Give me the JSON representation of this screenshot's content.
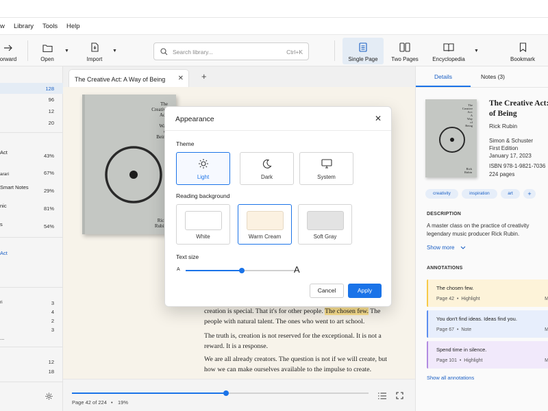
{
  "menu": [
    "w",
    "Library",
    "Tools",
    "Help"
  ],
  "toolbar": {
    "forward_label": "orward",
    "open_label": "Open",
    "import_label": "Import",
    "search_placeholder": "Search library...",
    "search_shortcut": "Ctrl+K",
    "single_page_label": "Single Page",
    "two_pages_label": "Two Pages",
    "encyclopedia_label": "Encyclopedia",
    "bookmark_label": "Bookmark"
  },
  "sidebar": {
    "top_counts": [
      "128",
      "96",
      "12",
      "20"
    ],
    "reading": [
      {
        "label": "Act",
        "value": "43%"
      },
      {
        "label": "arari",
        "value": "67%"
      },
      {
        "label": "Smart Notes",
        "value": "29%"
      },
      {
        "label": "nic",
        "value": "81%"
      },
      {
        "label": "s",
        "value": "54%"
      }
    ],
    "active_item": "Act",
    "authors": [
      {
        "label": "ri",
        "value": "3"
      },
      {
        "label": "",
        "value": "4"
      },
      {
        "label": "",
        "value": "2"
      },
      {
        "label": "",
        "value": "3"
      },
      {
        "label": "...",
        "value": ""
      }
    ],
    "bottom_counts": [
      "12",
      "18"
    ]
  },
  "tabs": {
    "active_title": "The Creative Act: A Way of Being"
  },
  "cover": {
    "title_lines": [
      "The",
      "Creative",
      "Act:",
      "A",
      "Way",
      "of",
      "Being"
    ],
    "author_lines": [
      "Rick",
      "Rubin"
    ]
  },
  "reader": {
    "para1_prefix": "creation is special. That it's for other people. ",
    "para1_highlight": "The chosen few.",
    "para1_suffix": " The people with natural talent. The ones who went to art school.",
    "para2": "The truth is, creation is not reserved for the exceptional. It is not a reward. It is a response.",
    "para3": "We are all already creators. The question is not if we will create, but how we can make ourselves available to the impulse to create."
  },
  "progress": {
    "page_label": "Page 42 of 224",
    "separator": "•",
    "percent_label": "19%",
    "fraction": 0.19
  },
  "details": {
    "tab_details": "Details",
    "tab_notes": "Notes (3)",
    "title": "The Creative Act: A Way of Being",
    "title_line1": "The Creative Act:",
    "title_line2": "of Being",
    "author": "Rick Rubin",
    "publisher": "Simon & Schuster",
    "edition": "First Edition",
    "date": "January 17, 2023",
    "isbn": "ISBN 978-1-9821-7036",
    "pages": "224 pages",
    "tags": [
      "creativity",
      "inspiration",
      "art",
      "+"
    ],
    "description_heading": "DESCRIPTION",
    "description_line1": "A master class on the practice of creativity",
    "description_line2": "legendary music producer Rick Rubin.",
    "show_more": "Show more",
    "annotations_heading": "ANNOTATIONS",
    "annotations": [
      {
        "quote": "The chosen few.",
        "page": "Page 42",
        "type": "Highlight",
        "extra": "M",
        "color": "#f7c948",
        "bg": "#fdf3d9"
      },
      {
        "quote": "You don't find ideas. Ideas find you.",
        "page": "Page 67",
        "type": "Note",
        "extra": "M",
        "color": "#5b8def",
        "bg": "#e7eefc"
      },
      {
        "quote": "Spend time in silence.",
        "page": "Page 101",
        "type": "Highlight",
        "extra": "M",
        "color": "#b18be0",
        "bg": "#f1e9fb"
      }
    ],
    "bullet": "•",
    "show_all": "Show all annotations"
  },
  "modal": {
    "title": "Appearance",
    "theme_label": "Theme",
    "themes": [
      "Light",
      "Dark",
      "System"
    ],
    "selected_theme": "Light",
    "bg_label": "Reading background",
    "backgrounds": [
      {
        "label": "White",
        "color": "#ffffff"
      },
      {
        "label": "Warm Cream",
        "color": "#fbf1e1"
      },
      {
        "label": "Soft Gray",
        "color": "#e3e3e3"
      }
    ],
    "selected_bg": "Warm Cream",
    "text_size_label": "Text size",
    "small_a": "A",
    "big_a": "A",
    "text_size_fraction": 0.51,
    "cancel": "Cancel",
    "apply": "Apply"
  },
  "colors": {
    "accent": "#1a73e8",
    "reader_bg": "#f7f3ea",
    "highlight": "#fbe08f"
  }
}
